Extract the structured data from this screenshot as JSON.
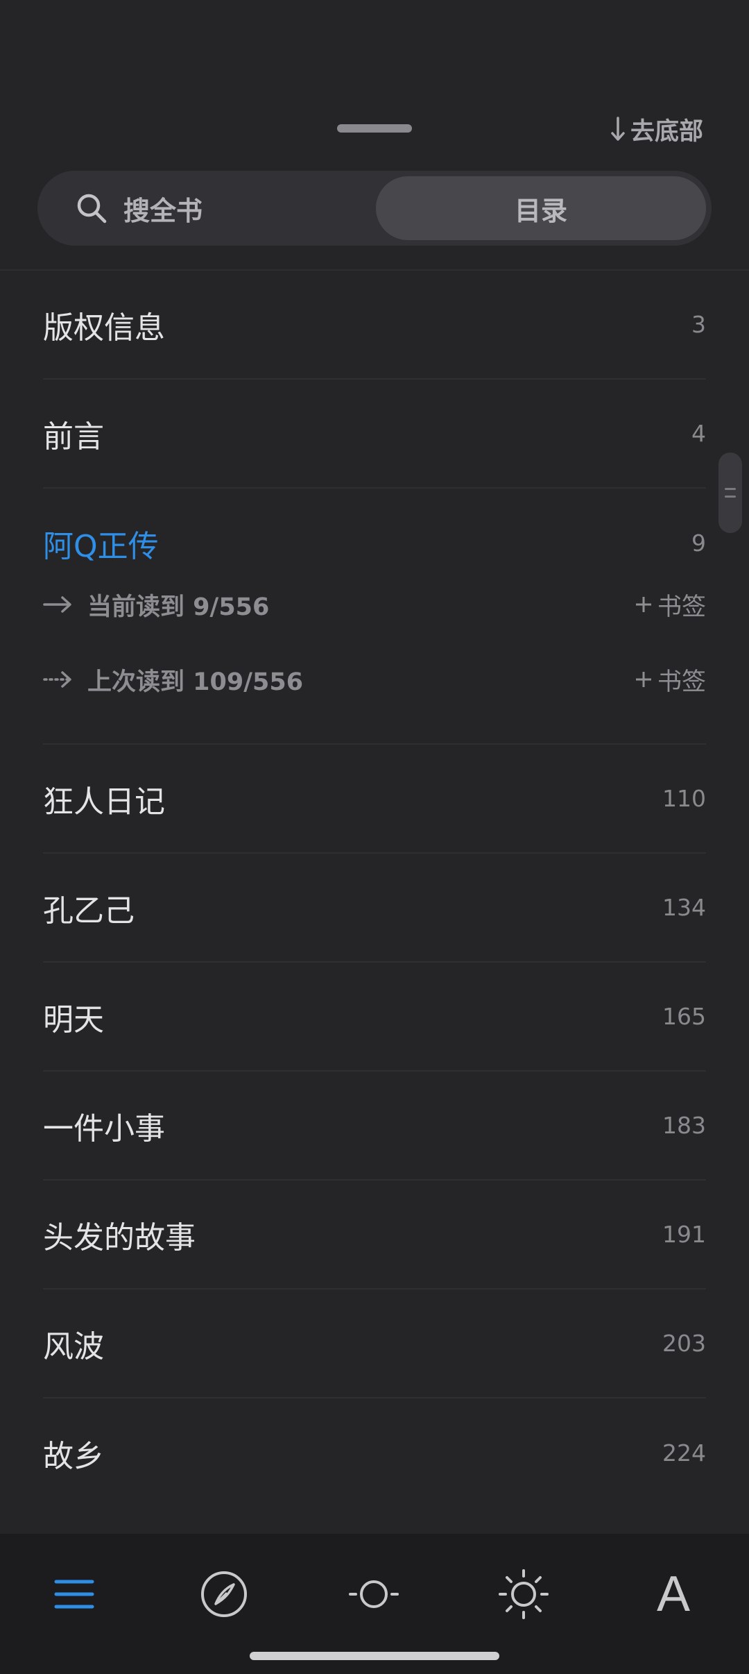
{
  "header": {
    "go_bottom_label": "去底部"
  },
  "segmented": {
    "search_label": "搜全书",
    "toc_label": "目录"
  },
  "toc": {
    "items": [
      {
        "title": "版权信息",
        "page": "3"
      },
      {
        "title": "前言",
        "page": "4"
      },
      {
        "title": "阿Q正传",
        "page": "9"
      },
      {
        "title": "狂人日记",
        "page": "110"
      },
      {
        "title": "孔乙己",
        "page": "134"
      },
      {
        "title": "明天",
        "page": "165"
      },
      {
        "title": "一件小事",
        "page": "183"
      },
      {
        "title": "头发的故事",
        "page": "191"
      },
      {
        "title": "风波",
        "page": "203"
      },
      {
        "title": "故乡",
        "page": "224"
      }
    ],
    "current_reading": "当前读到 9/556",
    "last_reading": "上次读到 109/556",
    "bookmark_label": "书签"
  },
  "toolbar": {
    "items": [
      "menu-icon",
      "compass-icon",
      "scroll-mode-icon",
      "brightness-icon",
      "font-icon"
    ],
    "font_label": "A",
    "active_color": "#2f8ee6"
  },
  "colors": {
    "background": "#252528",
    "accent": "#2f8ee6",
    "toolbar": "#1c1c1e"
  }
}
